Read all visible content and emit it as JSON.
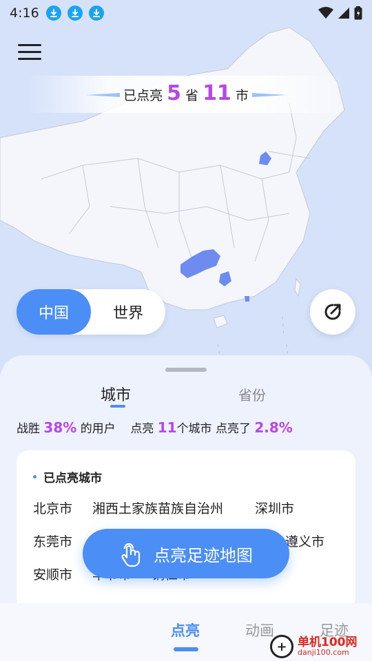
{
  "status_bar": {
    "time": "4:16",
    "download_icons": [
      "download-icon",
      "download-icon",
      "download-icon"
    ]
  },
  "map": {
    "lit_prefix": "已点亮",
    "province_count": "5",
    "province_unit": "省",
    "city_count": "11",
    "city_unit": "市",
    "highlight_color": "#6e8cf0"
  },
  "region_toggle": {
    "china": "中国",
    "world": "世界"
  },
  "sheet": {
    "tab_city": "城市",
    "tab_province": "省份",
    "stats": {
      "beat_prefix": "战胜",
      "beat_percent": "38%",
      "beat_suffix": "的用户",
      "lit_prefix": "点亮",
      "lit_count": "11",
      "lit_suffix": "个城市",
      "lit2_prefix": "点亮了",
      "lit2_percent": "2.8%"
    },
    "card_title": "已点亮城市",
    "cities": [
      "北京市",
      "湘西土家族苗族自治州",
      "深圳市",
      "东莞市",
      "遵义市",
      "安顺市",
      "毕节市",
      "铜仁市"
    ]
  },
  "cta": {
    "label": "点亮足迹地图"
  },
  "bottom_nav": {
    "items": [
      "点亮",
      "动画",
      "足迹"
    ]
  },
  "watermark": {
    "brand": "单机100网",
    "url": "danji100.com"
  },
  "colors": {
    "accent": "#4a8ef6",
    "highlight": "#b548e6"
  }
}
